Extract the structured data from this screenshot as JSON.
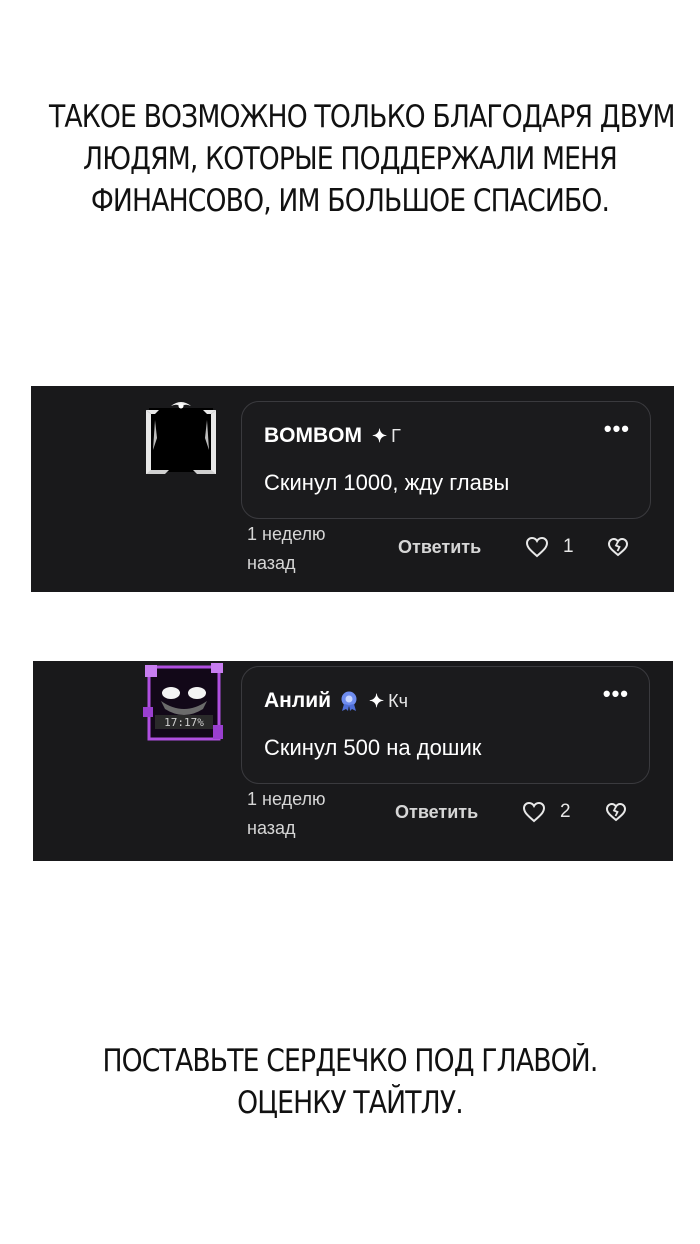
{
  "caption_top": {
    "line1": "ТАКОЕ ВОЗМОЖНО ТОЛЬКО БЛАГОДАРЯ ДВУМ",
    "line2": "ЛЮДЯМ, КОТОРЫЕ ПОДДЕРЖАЛИ МЕНЯ",
    "line3": "ФИНАНСОВО, ИМ БОЛЬШОЕ СПАСИБО."
  },
  "comments": [
    {
      "username": "BOMBOM",
      "spark": "✦",
      "tag": "Г",
      "more": "•••",
      "text": "Скинул 1000, жду главы",
      "time_line1": "1 неделю",
      "time_line2": "назад",
      "reply_label": "Ответить",
      "like_count": "1",
      "avatar_icon": "avatar-frame-icon"
    },
    {
      "username": "Анлий",
      "spark": "✦",
      "tag": "Кч",
      "more": "•••",
      "text": "Скинул 500 на дошик",
      "time_line1": "1 неделю",
      "time_line2": "назад",
      "reply_label": "Ответить",
      "like_count": "2",
      "avatar_icon": "avatar-frame-icon",
      "badge_icon": "verified-badge-icon"
    }
  ],
  "caption_bottom": {
    "line1": "ПОСТАВЬТЕ СЕРДЕЧКО ПОД ГЛАВОЙ.",
    "line2": "ОЦЕНКУ ТАЙТЛУ."
  },
  "colors": {
    "panel_bg": "#19191b",
    "bubble_border": "#3a3a3e",
    "badge_blue": "#6f8df0",
    "avatar_purple": "#b04fe0"
  }
}
